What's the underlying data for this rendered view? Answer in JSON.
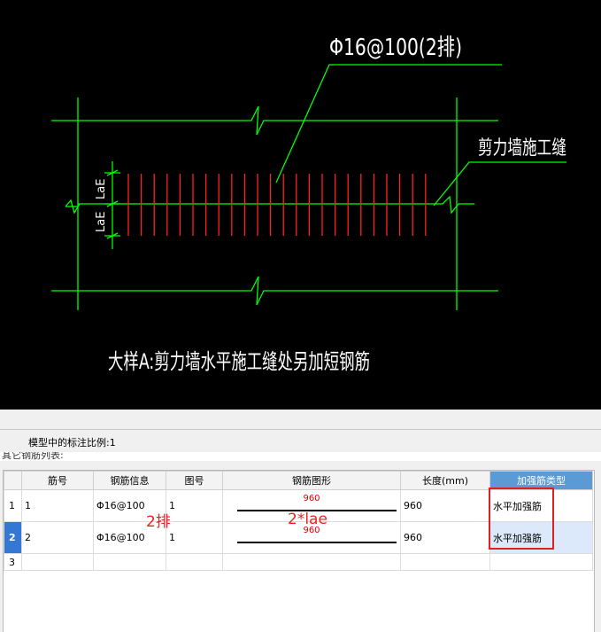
{
  "drawing": {
    "rebar_label": "Φ16@100(2排)",
    "joint_label": "剪力墙施工缝",
    "dim_upper": "LaE",
    "dim_lower": "LaE",
    "caption": "大样A:剪力墙水平施工缝处另加短钢筋",
    "colors": {
      "background": "#000000",
      "wall": "#00ff00",
      "rebar": "#ff2020",
      "text": "#ffffff"
    }
  },
  "toolbar": {
    "scale_label": "模型中的标注比例:1"
  },
  "panel": {
    "title": "其它钢筋列表:"
  },
  "table": {
    "headers": [
      "",
      "筋号",
      "钢筋信息",
      "图号",
      "钢筋图形",
      "长度(mm)",
      "加强筋类型"
    ],
    "rows": [
      {
        "num": "1",
        "bar": "1",
        "info": "Φ16@100",
        "fig": "1",
        "shape_value": "960",
        "length": "960",
        "type": "水平加强筋"
      },
      {
        "num": "2",
        "bar": "2",
        "info": "Φ16@100",
        "fig": "1",
        "shape_value": "960",
        "length": "960",
        "type": "水平加强筋"
      },
      {
        "num": "3",
        "bar": "",
        "info": "",
        "fig": "",
        "shape_value": "",
        "length": "",
        "type": ""
      }
    ]
  },
  "annotations": {
    "rows_note": "2排",
    "length_note": "2*lae"
  }
}
